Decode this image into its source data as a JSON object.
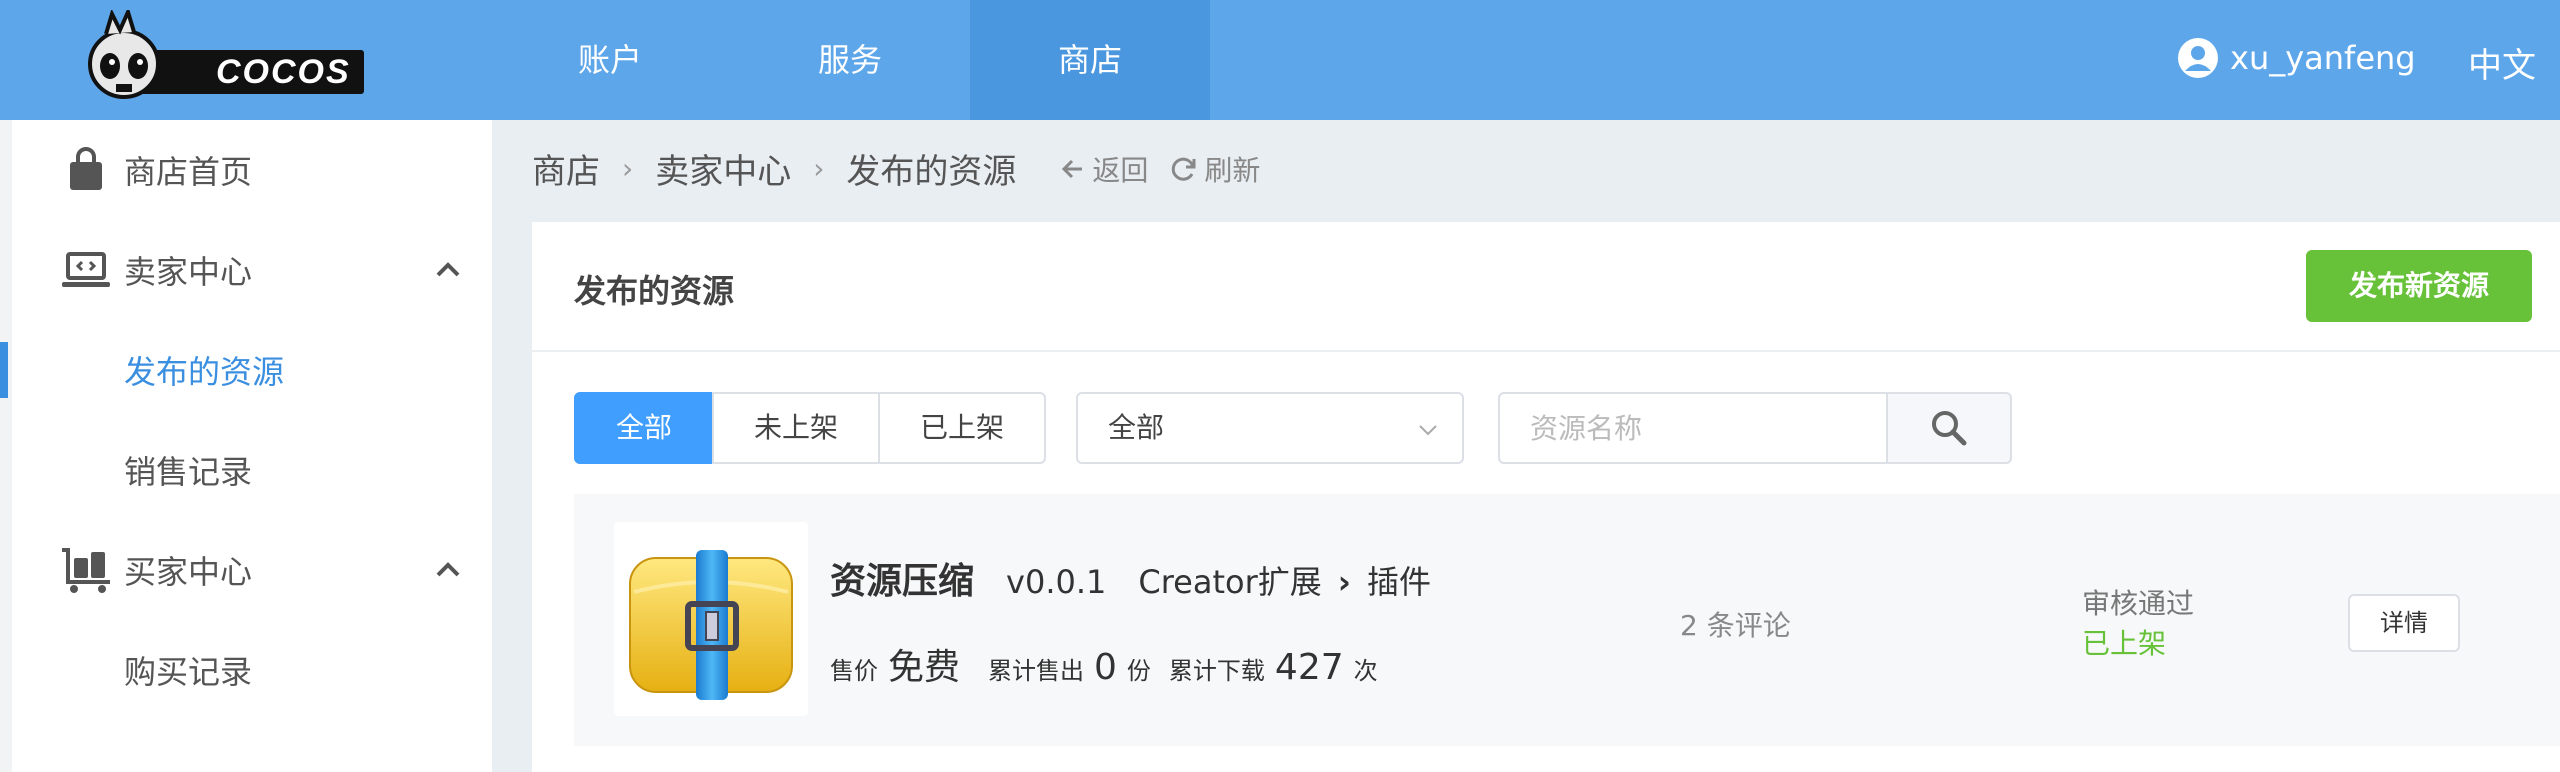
{
  "header": {
    "logo_text": "COCOS",
    "nav": [
      {
        "label": "账户"
      },
      {
        "label": "服务"
      },
      {
        "label": "商店"
      }
    ],
    "username": "xu_yanfeng",
    "language": "中文"
  },
  "sidebar": {
    "store_home": "商店首页",
    "seller_center": "卖家中心",
    "published_resources": "发布的资源",
    "sales_records": "销售记录",
    "buyer_center": "买家中心",
    "purchase_records": "购买记录"
  },
  "breadcrumb": {
    "items": [
      "商店",
      "卖家中心",
      "发布的资源"
    ],
    "back": "返回",
    "refresh": "刷新"
  },
  "panel": {
    "title": "发布的资源",
    "publish_button": "发布新资源",
    "filters": [
      "全部",
      "未上架",
      "已上架"
    ],
    "select_value": "全部",
    "search_placeholder": "资源名称"
  },
  "item": {
    "name": "资源压缩",
    "version": "v0.0.1",
    "category": "Creator扩展",
    "subcategory": "插件",
    "price_label": "售价",
    "price": "免费",
    "sold_label": "累计售出",
    "sold": "0",
    "sold_unit": "份",
    "downloads_label": "累计下载",
    "downloads": "427",
    "downloads_unit": "次",
    "reviews": "2 条评论",
    "review_status": "审核通过",
    "listing_status": "已上架",
    "detail_button": "详情"
  },
  "colors": {
    "header_bg": "#5ea6ea",
    "accent": "#409eff",
    "success": "#67c23a"
  }
}
